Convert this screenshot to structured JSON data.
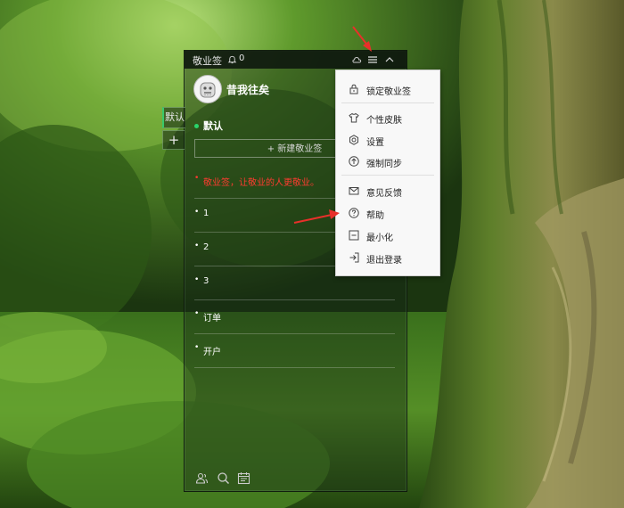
{
  "window": {
    "app_name": "敬业签",
    "notification_count": "0",
    "icons": [
      "bell-icon",
      "cloud-icon",
      "menu-icon",
      "collapse-up-icon"
    ]
  },
  "side_tabs": [
    {
      "label": "默认",
      "active": true
    },
    {
      "label": "+"
    }
  ],
  "profile": {
    "username": "昔我往矣",
    "avatar": "avatar-face-icon"
  },
  "category": {
    "label": "默认",
    "dot_color": "#2ad56b"
  },
  "new_note_button": {
    "label": "+ 新建敬业签"
  },
  "notes": [
    {
      "text": "敬业签，让敬业的人更敬业。",
      "color": "#ff3b30"
    },
    {
      "text": "1"
    },
    {
      "text": "2"
    },
    {
      "text": "3"
    },
    {
      "text": "订单"
    },
    {
      "text": "开户"
    }
  ],
  "bottom_bar": {
    "icons": [
      "contacts-icon",
      "search-icon",
      "calendar-icon"
    ]
  },
  "menu": {
    "groups": [
      [
        {
          "label": "锁定敬业签",
          "icon": "lock-icon"
        }
      ],
      [
        {
          "label": "个性皮肤",
          "icon": "shirt-icon"
        },
        {
          "label": "设置",
          "icon": "settings-icon"
        },
        {
          "label": "强制同步",
          "icon": "sync-up-icon"
        }
      ],
      [
        {
          "label": "意见反馈",
          "icon": "mail-icon"
        },
        {
          "label": "帮助",
          "icon": "help-icon"
        },
        {
          "label": "最小化",
          "icon": "minimize-icon"
        },
        {
          "label": "退出登录",
          "icon": "logout-icon"
        }
      ]
    ]
  },
  "colors": {
    "arrow": "#e8302a",
    "accent": "#2ad56b",
    "panel_titlebar": "#0e180e"
  }
}
